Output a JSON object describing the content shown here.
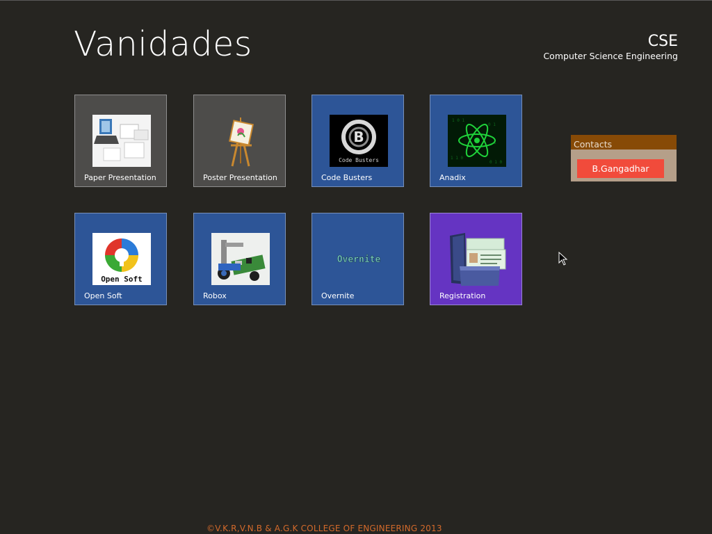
{
  "header": {
    "title": "Vanidades",
    "dept_code": "CSE",
    "dept_name": "Computer Science Engineering"
  },
  "tiles": [
    {
      "label": "Paper Presentation",
      "icon": "paper-presentation-icon",
      "color": "#4d4c4a"
    },
    {
      "label": "Poster Presentation",
      "icon": "easel-icon",
      "color": "#4d4c4a"
    },
    {
      "label": "Code Busters",
      "icon": "code-busters-logo",
      "color": "#2d5597",
      "logo_text": "Code Busters"
    },
    {
      "label": "Anadix",
      "icon": "atom-icon",
      "color": "#2d5597"
    },
    {
      "label": "Open Soft",
      "icon": "open-soft-logo",
      "color": "#2d5597",
      "logo_text": "Open Soft"
    },
    {
      "label": "Robox",
      "icon": "robot-icon",
      "color": "#2d5597"
    },
    {
      "label": "Overnite",
      "icon": "overnite-logo",
      "color": "#2d5597",
      "logo_text": "Overnite"
    },
    {
      "label": "Registration",
      "icon": "id-card-folder-icon",
      "color": "#6534c2"
    }
  ],
  "contacts": {
    "heading": "Contacts",
    "person": "B.Gangadhar"
  },
  "footer": {
    "text": "©V.K.R,V.N.B & A.G.K COLLEGE OF ENGINEERING 2013"
  },
  "colors": {
    "background": "#262521",
    "tile_gray": "#4d4c4a",
    "tile_blue": "#2d5597",
    "tile_purple": "#6534c2",
    "contacts_header": "#874a06",
    "contact_button": "#f14b3b",
    "footer_text": "#d36a2b"
  }
}
